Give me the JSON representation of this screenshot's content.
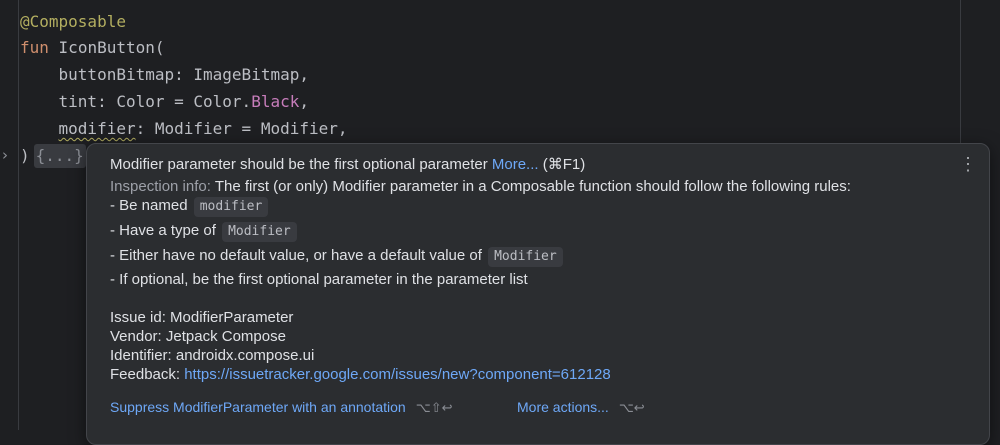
{
  "code": {
    "annotation": "@Composable",
    "fun_kw": "fun",
    "fun_name": "IconButton(",
    "p1_name": "buttonBitmap",
    "p1_rest": ": ImageBitmap,",
    "p2_name": "tint",
    "p2_mid": ": Color = Color.",
    "p2_value": "Black",
    "p2_end": ",",
    "p3_name": "modifier",
    "p3_rest": ": Modifier = Modifier,",
    "close_paren": ")",
    "folded_body": "{...}"
  },
  "popup": {
    "title": "Modifier parameter should be the first optional parameter",
    "title_more": "More...",
    "title_shortcut": "(⌘F1)",
    "info_label": "Inspection info:",
    "info_text": "The first (or only) Modifier parameter in a Composable function should follow the following rules:",
    "rule1": "- Be named",
    "rule1_code": "modifier",
    "rule2": "- Have a type of",
    "rule2_code": "Modifier",
    "rule3": "- Either have no default value, or have a default value of",
    "rule3_code": "Modifier",
    "rule4": "- If optional, be the first optional parameter in the parameter list",
    "issue_id": "Issue id: ModifierParameter",
    "vendor": "Vendor: Jetpack Compose",
    "identifier": "Identifier: androidx.compose.ui",
    "feedback_label": "Feedback:",
    "feedback_url": "https://issuetracker.google.com/issues/new?component=612128",
    "suppress_action": "Suppress ModifierParameter with an annotation",
    "suppress_shortcut": "⌥⇧↩",
    "more_actions": "More actions...",
    "more_actions_shortcut": "⌥↩",
    "menu_icon": "⋮"
  },
  "icons": {
    "fold": "chevron-right-icon",
    "menu": "vertical-ellipsis-icon"
  },
  "colors": {
    "editor_bg": "#1e1f22",
    "popup_bg": "#2b2d30",
    "link": "#6ea8f7",
    "keyword": "#cf8e6d",
    "annotation": "#b3ae60",
    "constant": "#c77dbb"
  }
}
